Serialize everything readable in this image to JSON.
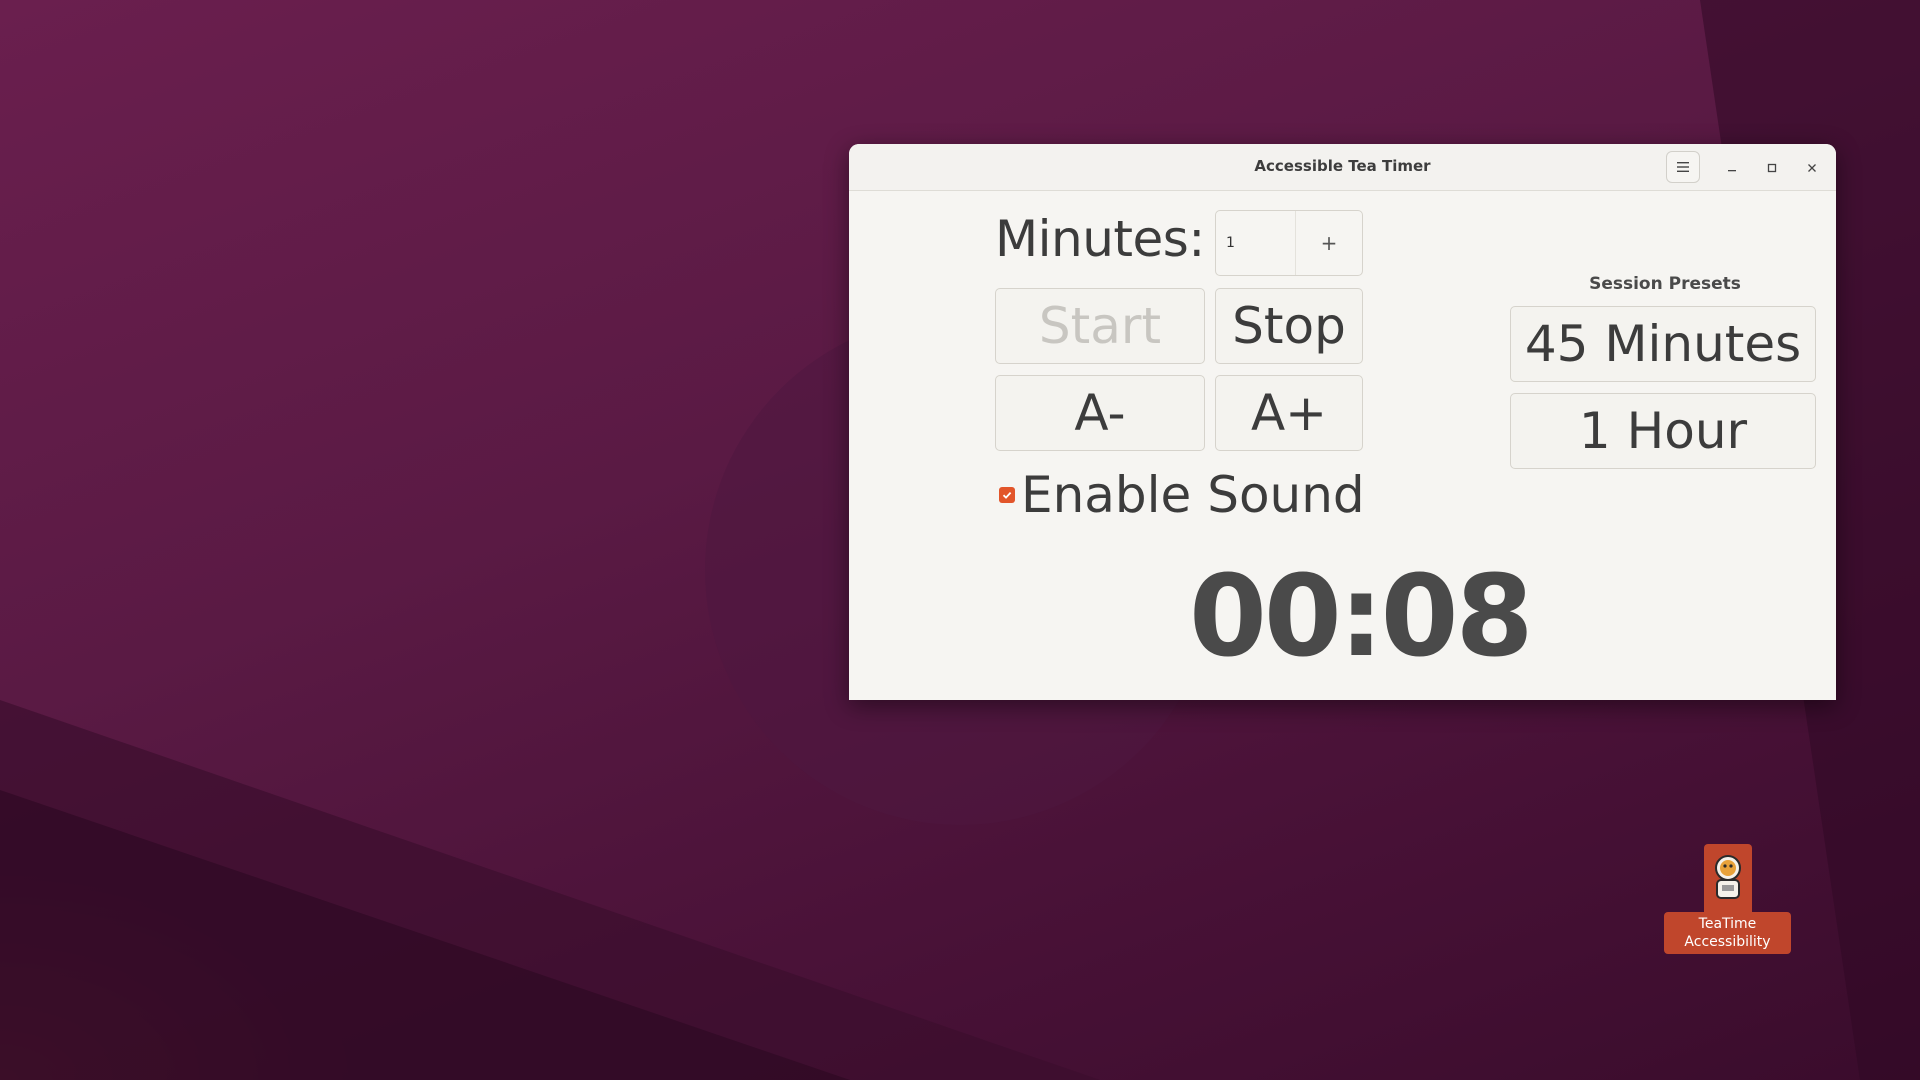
{
  "window": {
    "title": "Accessible Tea Timer"
  },
  "timer_controls": {
    "minutes_label": "Minutes:",
    "minutes_value": "1",
    "increment_symbol": "+",
    "start_label": "Start",
    "stop_label": "Stop",
    "font_decrease_label": "A-",
    "font_increase_label": "A+",
    "sound_label": "Enable Sound",
    "sound_enabled": true,
    "countdown": "00:08"
  },
  "presets": {
    "title": "Session Presets",
    "items": [
      "45 Minutes",
      "1 Hour"
    ]
  },
  "desktop": {
    "icon_label_line1": "TeaTime",
    "icon_label_line2": "Accessibility",
    "icon": "astronaut-icon"
  },
  "colors": {
    "accent": "#e2552a",
    "desktop_background": "#5a1a44",
    "window_background": "#f6f5f2",
    "desktop_icon_highlight": "#c0462c"
  }
}
